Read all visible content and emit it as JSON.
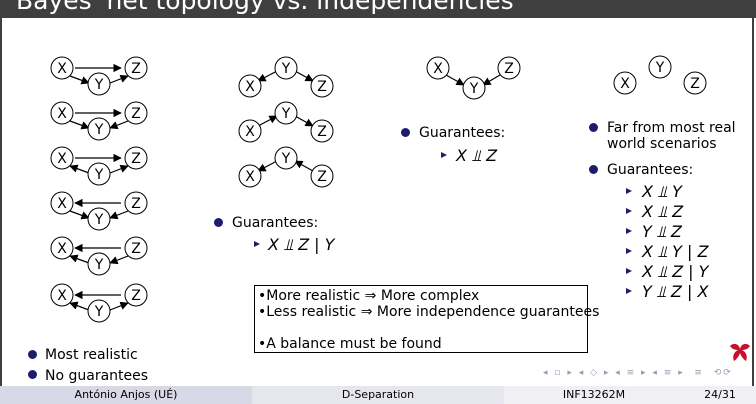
{
  "title": "Bayes' net topology vs. independencies",
  "nodes": {
    "x": "X",
    "y": "Y",
    "z": "Z"
  },
  "col1": {
    "bullet1": "Most realistic",
    "bullet2": "No guarantees"
  },
  "col2": {
    "heading": "Guarantees:",
    "item1": "X ⫫ Z | Y"
  },
  "col3": {
    "heading": "Guarantees:",
    "item1": "X ⫫ Z"
  },
  "col4": {
    "bullet1_line1": "Far from most real",
    "bullet1_line2": "world scenarios",
    "heading": "Guarantees:",
    "items": [
      "X ⫫ Y",
      "X ⫫ Z",
      "Y ⫫ Z",
      "X ⫫ Y | Z",
      "X ⫫ Z | Y",
      "Y ⫫ Z | X"
    ]
  },
  "box": {
    "line1": "•More realistic ⇒ More complex",
    "line2": "•Less realistic ⇒ More independence guarantees",
    "line3": "•A balance must be found"
  },
  "footer": {
    "author": "António Anjos (UÉ)",
    "topic": "D-Separation",
    "course": "INF13262M",
    "page": "24/31"
  },
  "colors": {
    "titlebar": "#3f3f3f",
    "bullet": "#1d1d6b",
    "footer_left": "#d8d8e6",
    "footer_mid": "#e6e6ee",
    "footer_right": "#f0f0f4",
    "logo": "#c8102e"
  }
}
